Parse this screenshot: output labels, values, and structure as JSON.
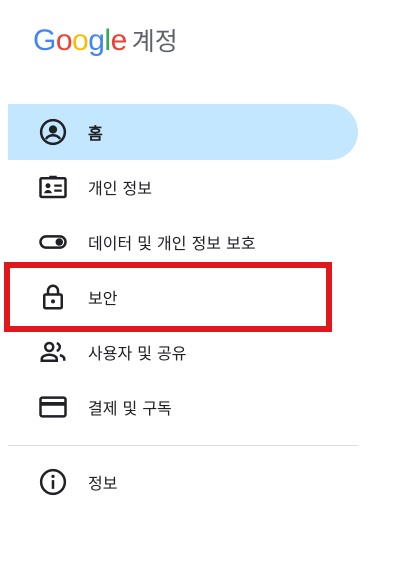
{
  "header": {
    "logo_word": "Google",
    "product_name": "계정",
    "logo_colors": [
      "#4285F4",
      "#EA4335",
      "#FBBC05",
      "#4285F4",
      "#34A853",
      "#EA4335"
    ]
  },
  "nav": {
    "items": [
      {
        "label": "홈",
        "icon": "account-circle-icon",
        "active": true
      },
      {
        "label": "개인 정보",
        "icon": "id-card-icon",
        "active": false
      },
      {
        "label": "데이터 및 개인 정보 보호",
        "icon": "toggle-icon",
        "active": false
      },
      {
        "label": "보안",
        "icon": "lock-icon",
        "active": false
      },
      {
        "label": "사용자 및 공유",
        "icon": "people-icon",
        "active": false
      },
      {
        "label": "결제 및 구독",
        "icon": "credit-card-icon",
        "active": false
      }
    ],
    "secondary_items": [
      {
        "label": "정보",
        "icon": "info-icon",
        "active": false
      }
    ]
  },
  "colors": {
    "active_bg": "#c2e7ff",
    "highlight_border": "#e0181c",
    "text": "#202124",
    "divider": "#dadce0"
  }
}
